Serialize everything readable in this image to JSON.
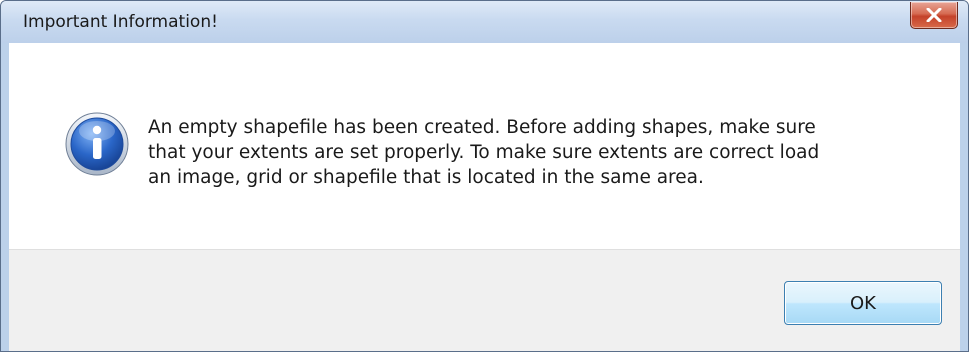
{
  "dialog": {
    "title": "Important Information!",
    "close_icon": "close-x-icon",
    "info_icon": "info-icon",
    "message_lines": [
      "An empty shapefile has been created. Before adding shapes, make sure",
      "that your extents are set properly. To make sure extents are correct load",
      "an image, grid or shapefile that is located in the same area."
    ],
    "ok_label": "OK"
  },
  "colors": {
    "title_bar": "#c9daf0",
    "close_button": "#c4422a",
    "info_icon": "#2a66c8",
    "footer": "#f0f0f0",
    "ok_button_border": "#3c7fb1"
  }
}
